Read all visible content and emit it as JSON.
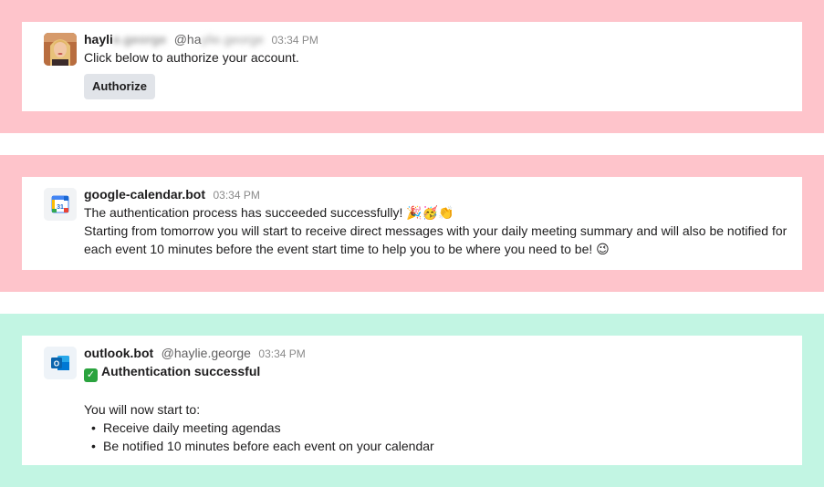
{
  "messages": [
    {
      "user_prefix": "hayli",
      "user_blurred": "e.george",
      "handle_prefix": "@ha",
      "handle_blurred": "ylie.george",
      "time": "03:34 PM",
      "text": "Click below to authorize your account.",
      "button_label": "Authorize"
    },
    {
      "user": "google-calendar.bot",
      "time": "03:34 PM",
      "line1": "The authentication process has succeeded successfully! 🎉🥳👏",
      "line2": "Starting from tomorrow you will start to receive direct messages with your daily meeting summary and will also be notified for each event 10 minutes before the event start time to help you to be where you need to be! 😉",
      "icon_label": "31"
    },
    {
      "user": "outlook.bot",
      "handle": "@haylie.george",
      "time": "03:34 PM",
      "status_icon": "✓",
      "heading": "Authentication successful",
      "intro": "You will now start to:",
      "bullets": [
        "Receive daily meeting agendas",
        "Be notified 10 minutes before each event on your calendar"
      ],
      "icon_label": "O"
    }
  ],
  "colors": {
    "band_pink": "#fec4cb",
    "band_mint": "#c2f5e3",
    "button_bg": "#e1e4e9"
  }
}
